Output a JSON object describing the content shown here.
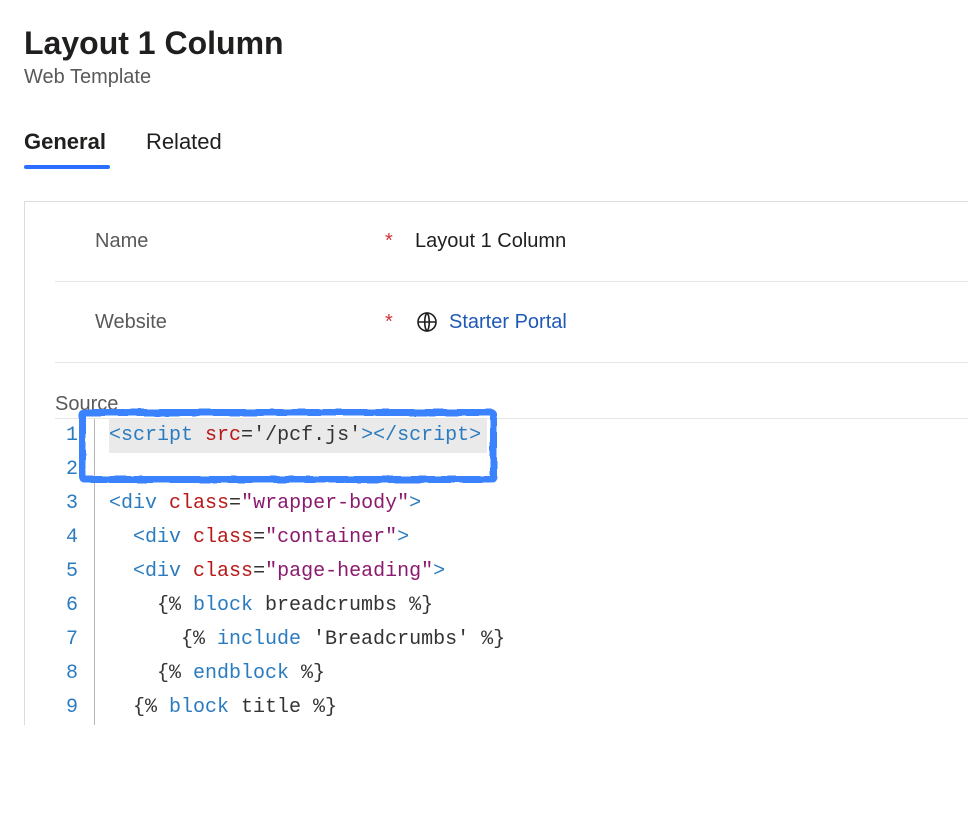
{
  "header": {
    "title": "Layout 1 Column",
    "subtitle": "Web Template"
  },
  "tabs": {
    "general": "General",
    "related": "Related"
  },
  "fields": {
    "name_label": "Name",
    "name_value": "Layout 1 Column",
    "website_label": "Website",
    "website_value": "Starter Portal"
  },
  "source": {
    "label": "Source",
    "lines": [
      {
        "n": "1",
        "tokens": [
          {
            "t": "<",
            "c": "tag"
          },
          {
            "t": "script ",
            "c": "tag"
          },
          {
            "t": "src",
            "c": "attr"
          },
          {
            "t": "=",
            "c": "punct"
          },
          {
            "t": "'/pcf.js'",
            "c": "punct"
          },
          {
            "t": ">",
            "c": "tag"
          },
          {
            "t": "</",
            "c": "tag"
          },
          {
            "t": "script",
            "c": "tag"
          },
          {
            "t": ">",
            "c": "tag"
          }
        ],
        "highlight": true,
        "current": true
      },
      {
        "n": "2",
        "tokens": []
      },
      {
        "n": "3",
        "tokens": [
          {
            "t": "<",
            "c": "tag"
          },
          {
            "t": "div ",
            "c": "tag"
          },
          {
            "t": "class",
            "c": "attr"
          },
          {
            "t": "=",
            "c": "punct"
          },
          {
            "t": "\"wrapper-body\"",
            "c": "str"
          },
          {
            "t": ">",
            "c": "tag"
          }
        ]
      },
      {
        "n": "4",
        "tokens": [
          {
            "t": "  ",
            "c": "punct"
          },
          {
            "t": "<",
            "c": "tag"
          },
          {
            "t": "div ",
            "c": "tag"
          },
          {
            "t": "class",
            "c": "attr"
          },
          {
            "t": "=",
            "c": "punct"
          },
          {
            "t": "\"container\"",
            "c": "str"
          },
          {
            "t": ">",
            "c": "tag"
          }
        ]
      },
      {
        "n": "5",
        "tokens": [
          {
            "t": "  ",
            "c": "punct"
          },
          {
            "t": "<",
            "c": "tag"
          },
          {
            "t": "div ",
            "c": "tag"
          },
          {
            "t": "class",
            "c": "attr"
          },
          {
            "t": "=",
            "c": "punct"
          },
          {
            "t": "\"page-heading\"",
            "c": "str"
          },
          {
            "t": ">",
            "c": "tag"
          }
        ]
      },
      {
        "n": "6",
        "tokens": [
          {
            "t": "    {% ",
            "c": "liquid"
          },
          {
            "t": "block",
            "c": "kw"
          },
          {
            "t": " breadcrumbs ",
            "c": "lname"
          },
          {
            "t": "%}",
            "c": "liquid"
          }
        ]
      },
      {
        "n": "7",
        "tokens": [
          {
            "t": "      {% ",
            "c": "liquid"
          },
          {
            "t": "include",
            "c": "kw"
          },
          {
            "t": " 'Breadcrumbs' ",
            "c": "lname"
          },
          {
            "t": "%}",
            "c": "liquid"
          }
        ]
      },
      {
        "n": "8",
        "tokens": [
          {
            "t": "    {% ",
            "c": "liquid"
          },
          {
            "t": "endblock",
            "c": "kw"
          },
          {
            "t": " ",
            "c": "lname"
          },
          {
            "t": "%}",
            "c": "liquid"
          }
        ]
      },
      {
        "n": "9",
        "tokens": [
          {
            "t": "  {% ",
            "c": "liquid"
          },
          {
            "t": "block",
            "c": "kw"
          },
          {
            "t": " title ",
            "c": "lname"
          },
          {
            "t": "%}",
            "c": "liquid"
          }
        ]
      }
    ]
  }
}
